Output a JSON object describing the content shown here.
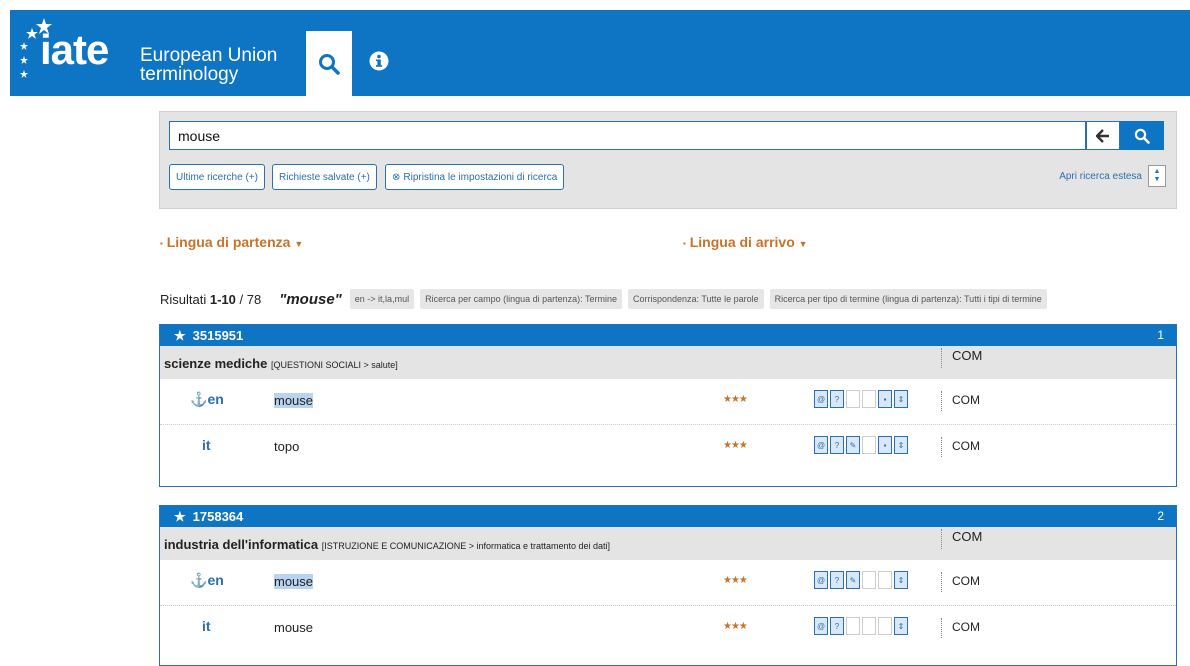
{
  "header": {
    "logo_text": "iate",
    "logo_sub_line1": "European Union",
    "logo_sub_line2": "terminology"
  },
  "search": {
    "value": "mouse",
    "last_searches": "Ultime ricerche (+)",
    "saved_requests": "Richieste salvate (+)",
    "reset": "Ripristina le impostazioni di ricerca",
    "open_extended": "Apri ricerca estesa"
  },
  "languages": {
    "source": "Lingua di partenza",
    "target": "Lingua di arrivo"
  },
  "results": {
    "label": "Risultati",
    "range": "1-10",
    "total": "/ 78",
    "term": "\"mouse\"",
    "chips": [
      "en -> it,la,mul",
      "Ricerca per campo (lingua di partenza): Termine",
      "Corrispondenza: Tutte le parole",
      "Ricerca per tipo di termine (lingua di partenza): Tutti i tipi di termine"
    ]
  },
  "entries": [
    {
      "id": "3515951",
      "index": "1",
      "domain": "scienze mediche",
      "domain_path": "[QUESTIONI SOCIALI > salute]",
      "domain_com": "COM",
      "terms": [
        {
          "lang": "en",
          "term": "mouse",
          "stars": "★★★",
          "com": "COM"
        },
        {
          "lang": "it",
          "term": "topo",
          "stars": "★★★",
          "com": "COM"
        }
      ]
    },
    {
      "id": "1758364",
      "index": "2",
      "domain": "industria dell'informatica",
      "domain_path": "[ISTRUZIONE E COMUNICAZIONE > informatica e trattamento dei dati]",
      "domain_com": "COM",
      "terms": [
        {
          "lang": "en",
          "term": "mouse",
          "stars": "★★★",
          "com": "COM"
        },
        {
          "lang": "it",
          "term": "mouse",
          "stars": "★★★",
          "com": "COM"
        }
      ]
    }
  ]
}
